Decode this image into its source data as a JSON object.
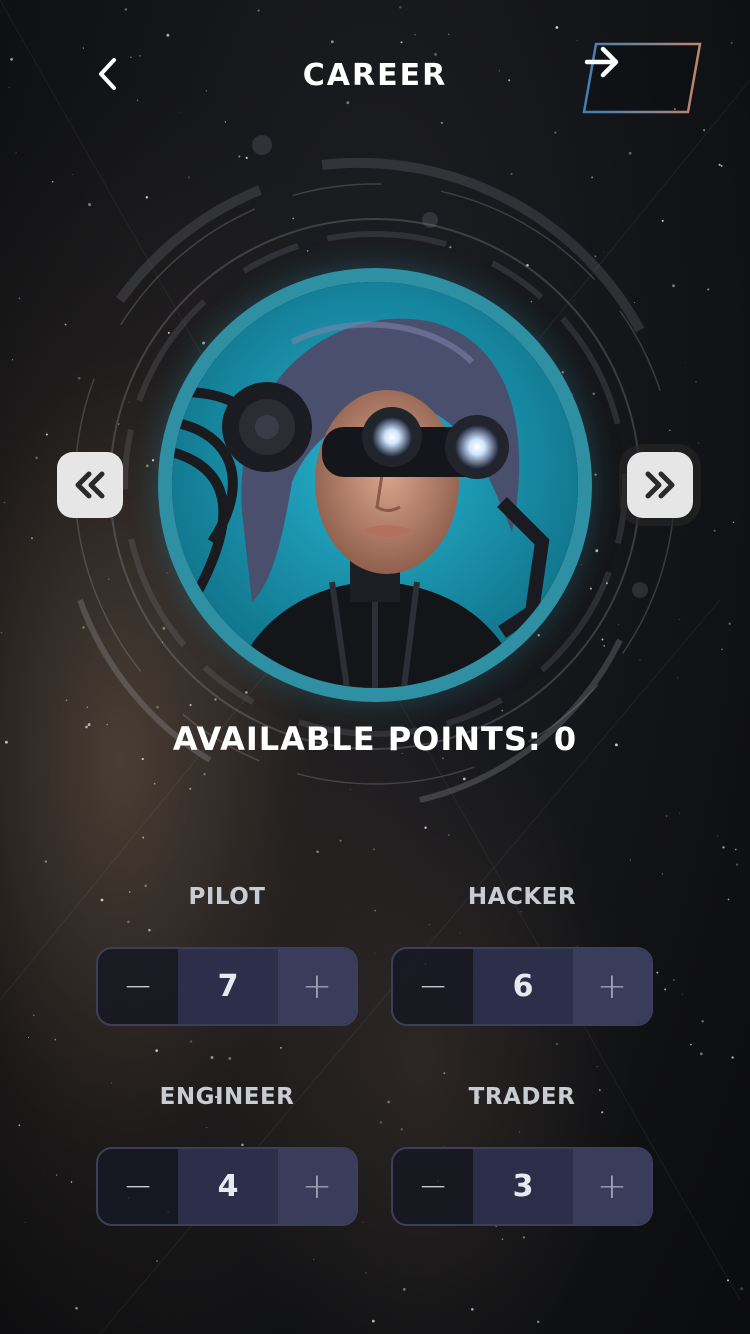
{
  "header": {
    "title": "CAREER",
    "back_icon": "chevron-left-icon",
    "next_icon": "arrow-right-icon"
  },
  "avatar": {
    "prev_icon": "double-chevron-left-icon",
    "next_icon": "double-chevron-right-icon",
    "ring_color": "#2f8fa3"
  },
  "points": {
    "text": "AVAILABLE POINTS: 0",
    "value": 0
  },
  "stats": [
    {
      "label": "PILOT",
      "value": "7",
      "minus": "−",
      "plus": "+"
    },
    {
      "label": "HACKER",
      "value": "6",
      "minus": "−",
      "plus": "+"
    },
    {
      "label": "ENGINEER",
      "value": "4",
      "minus": "−",
      "plus": "+"
    },
    {
      "label": "TRADER",
      "value": "3",
      "minus": "−",
      "plus": "+"
    }
  ],
  "colors": {
    "accent_teal": "#2f8fa3",
    "stepper_value_bg": "#2d2f4a",
    "stepper_plus_bg": "#3a3c5c",
    "stepper_border": "#3d3f5a"
  }
}
